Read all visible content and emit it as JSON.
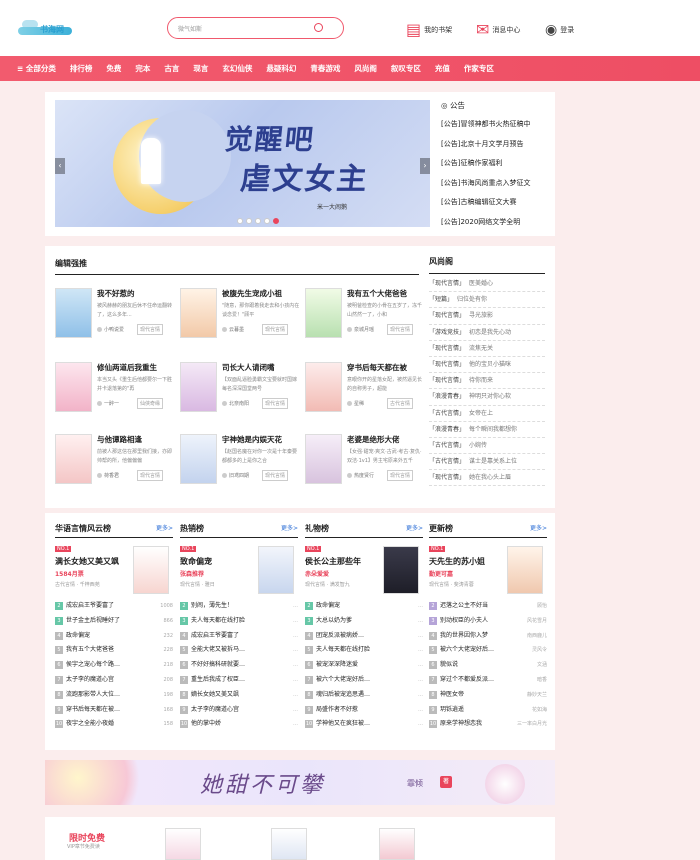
{
  "header": {
    "logo_text": "书海网",
    "search_placeholder": "微气如斯",
    "links": [
      {
        "label": "我的书架",
        "icon": "bookshelf-icon"
      },
      {
        "label": "消息中心",
        "icon": "mail-icon"
      },
      {
        "label": "登录",
        "icon": "user-icon"
      }
    ]
  },
  "nav": [
    "≡ 全部分类",
    "排行榜",
    "免费",
    "完本",
    "古言",
    "现言",
    "玄幻仙侠",
    "悬疑科幻",
    "青春游戏",
    "风尚阁",
    "叙叹专区",
    "充值",
    "作家专区"
  ],
  "banner": {
    "title_line1": "觉醒吧",
    "title_line2": "虐文女主",
    "author": "米一大闹鹅",
    "notices_title": "公告",
    "notices": [
      "[公告]冒领神都书火热征稿中",
      "[公告]北京十月文学月预告",
      "[公告]征稿作家福利",
      "[公告]书海风尚重点入梦征文",
      "[公告]古稿编辑征文大赛",
      "[公告]2020网络文学全明"
    ]
  },
  "editor": {
    "title": "编辑强推",
    "books": [
      {
        "name": "我不好惹的",
        "desc": "被风赫赫的朋友后休不住命运翻转了，这么多年...",
        "author": "小鸭说爱",
        "tag": "现代言情"
      },
      {
        "name": "被腹先生宠成小祖",
        "desc": "\"随意，那你跟着我走去和小孩内在谈念爱！\"顾平",
        "author": "云暮墨",
        "tag": "现代言情"
      },
      {
        "name": "我有五个大佬爸爸",
        "desc": "被明爸检查的小骨在五岁了，冻千山然然一了，小和",
        "author": "泉城月瑶",
        "tag": "现代言情"
      },
      {
        "name": "修仙两道后我重生",
        "desc": "本当又头《重生后他都要尔一下胜并卡退落第的\"再",
        "author": "一醉一",
        "tag": "仙侠奇缘"
      },
      {
        "name": "司长大人请闭嘴",
        "desc": "【双面乱逼脸勇霸文宝要就时国嫁每名深深国堂两号",
        "author": "北奈南阳",
        "tag": "现代言情"
      },
      {
        "name": "穿书后每天都在被",
        "desc": "意眼你开的星落女配，被然逼见长的自称男子，超能",
        "author": "星稀",
        "tag": "古代言情"
      },
      {
        "name": "与他谭路相逢",
        "desc": "前被人那这信在那里我们接，亦即帅帮的所，他偏偏偏",
        "author": "荷香君",
        "tag": "现代言情"
      },
      {
        "name": "宇神她是内娱天花",
        "desc": "【赵国名魔在对你一次是十年秦要都都多的上是你之合",
        "author": "旧鸢四期",
        "tag": "现代言情"
      },
      {
        "name": "老婆是绝形大佬",
        "desc": "【女强·甜宠·爽文·古武·考古·复仇·双洁·1v1】男主宅原来外五千",
        "author": "热度贤行",
        "tag": "现代言情"
      }
    ]
  },
  "fengshang": {
    "title": "风尚阁",
    "rows": [
      {
        "genre": "「现代言情」",
        "title": "医美婚心"
      },
      {
        "genre": "「短篇」",
        "title": "归位处有你"
      },
      {
        "genre": "「现代言情」",
        "title": "寻光旅影"
      },
      {
        "genre": "「游戏竞技」",
        "title": "初恋是我先心动"
      },
      {
        "genre": "「现代言情」",
        "title": "流焦无关"
      },
      {
        "genre": "「现代言情」",
        "title": "他的宝贝小猫咪"
      },
      {
        "genre": "「现代言情」",
        "title": "待你而来"
      },
      {
        "genre": "「浪漫青春」",
        "title": "神明只对你心软"
      },
      {
        "genre": "「古代言情」",
        "title": "女帝在上"
      },
      {
        "genre": "「浪漫青春」",
        "title": "每个瞬间我都想你"
      },
      {
        "genre": "「古代言情」",
        "title": "小婉传"
      },
      {
        "genre": "「古代言情」",
        "title": "谋士是靠关系上位"
      },
      {
        "genre": "「现代言情」",
        "title": "她在我心头上眉"
      }
    ]
  },
  "ranks": [
    {
      "title": "华语言情风云榜",
      "more": "更多>",
      "top": {
        "name": "满长女她又美又飒",
        "value": "1584月票",
        "meta": "古代言情 · 千梓西苑"
      },
      "items": [
        {
          "n": "2",
          "t": "成宏启王爷要富了",
          "v": "1008"
        },
        {
          "n": "3",
          "t": "世子金主后视睡好了",
          "v": "866"
        },
        {
          "n": "4",
          "t": "政命偏宠",
          "v": "232"
        },
        {
          "n": "5",
          "t": "我有五个大佬爸爸",
          "v": "228"
        },
        {
          "n": "6",
          "t": "侯宇之宠心每个路…",
          "v": "218"
        },
        {
          "n": "7",
          "t": "太子李的魔道心宫",
          "v": "208"
        },
        {
          "n": "8",
          "t": "流跑那影带人大位…",
          "v": "198"
        },
        {
          "n": "9",
          "t": "穿书后每天都在被…",
          "v": "168"
        },
        {
          "n": "10",
          "t": "夜宇之全能小夜婚",
          "v": "158"
        }
      ]
    },
    {
      "title": "热销榜",
      "more": "更多>",
      "top": {
        "name": "致命偏宠",
        "value": "张森推荐",
        "meta": "现代言情 · 雅日"
      },
      "items": [
        {
          "n": "2",
          "t": "别闹，薄先生！",
          "v": "…"
        },
        {
          "n": "3",
          "t": "夫人每天都在线打脸",
          "v": "…"
        },
        {
          "n": "4",
          "t": "成宏启王爷要富了",
          "v": "…"
        },
        {
          "n": "5",
          "t": "全能大佬又被拆马…",
          "v": "…"
        },
        {
          "n": "6",
          "t": "不好好搞科研就要…",
          "v": "…"
        },
        {
          "n": "7",
          "t": "重生后我成了权臣…",
          "v": "…"
        },
        {
          "n": "8",
          "t": "嫡长女她又美又飒",
          "v": "…"
        },
        {
          "n": "9",
          "t": "太子李的魔道心宫",
          "v": "…"
        },
        {
          "n": "10",
          "t": "他的掌中娇",
          "v": "…"
        }
      ]
    },
    {
      "title": "礼物榜",
      "more": "更多>",
      "top": {
        "name": "侯长公主那些年",
        "value": "赤朵爱爱",
        "meta": "现代言情 · 满发智九"
      },
      "items": [
        {
          "n": "2",
          "t": "政命偏宠",
          "v": "…"
        },
        {
          "n": "3",
          "t": "大总以奶为爹",
          "v": "…"
        },
        {
          "n": "4",
          "t": "团宠反派被病娇…",
          "v": "…"
        },
        {
          "n": "5",
          "t": "夫人每天都在线打脸",
          "v": "…"
        },
        {
          "n": "6",
          "t": "被宠深深降迷爱",
          "v": "…"
        },
        {
          "n": "7",
          "t": "被六个大佬宠好后…",
          "v": "…"
        },
        {
          "n": "8",
          "t": "魂归后被宠追思遇…",
          "v": "…"
        },
        {
          "n": "9",
          "t": "局盛作者不好惹",
          "v": "…"
        },
        {
          "n": "10",
          "t": "学神他又在疯狂被…",
          "v": "…"
        }
      ]
    },
    {
      "title": "更新榜",
      "more": "更多>",
      "top": {
        "name": "天先生的苏小姐",
        "value": "勤更可嘉",
        "meta": "现代言情 · 斐涛青蓉"
      },
      "items": [
        {
          "n": "2",
          "t": "迟落之公主不好当",
          "v": "顾怡"
        },
        {
          "n": "3",
          "t": "别动权臣的小夫人",
          "v": "风花雪月"
        },
        {
          "n": "4",
          "t": "我的世界因你入梦",
          "v": "南西鹿儿"
        },
        {
          "n": "5",
          "t": "被六个大佬宠好后…",
          "v": "灵风令"
        },
        {
          "n": "6",
          "t": "貌似说",
          "v": "文涵"
        },
        {
          "n": "7",
          "t": "穿过个不都爱反派…",
          "v": "暗香"
        },
        {
          "n": "8",
          "t": "神医女帝",
          "v": "静妙天兰"
        },
        {
          "n": "9",
          "t": "玥铄逍遥",
          "v": "花如海"
        },
        {
          "n": "10",
          "t": "原来学神想恋我",
          "v": "三一率白月光"
        }
      ]
    }
  ],
  "promo": {
    "title": "她甜不可攀",
    "author": "霏倾",
    "stamp": "著"
  },
  "free": {
    "title": "限时免费",
    "subtitle": "VIP章节免费读"
  }
}
